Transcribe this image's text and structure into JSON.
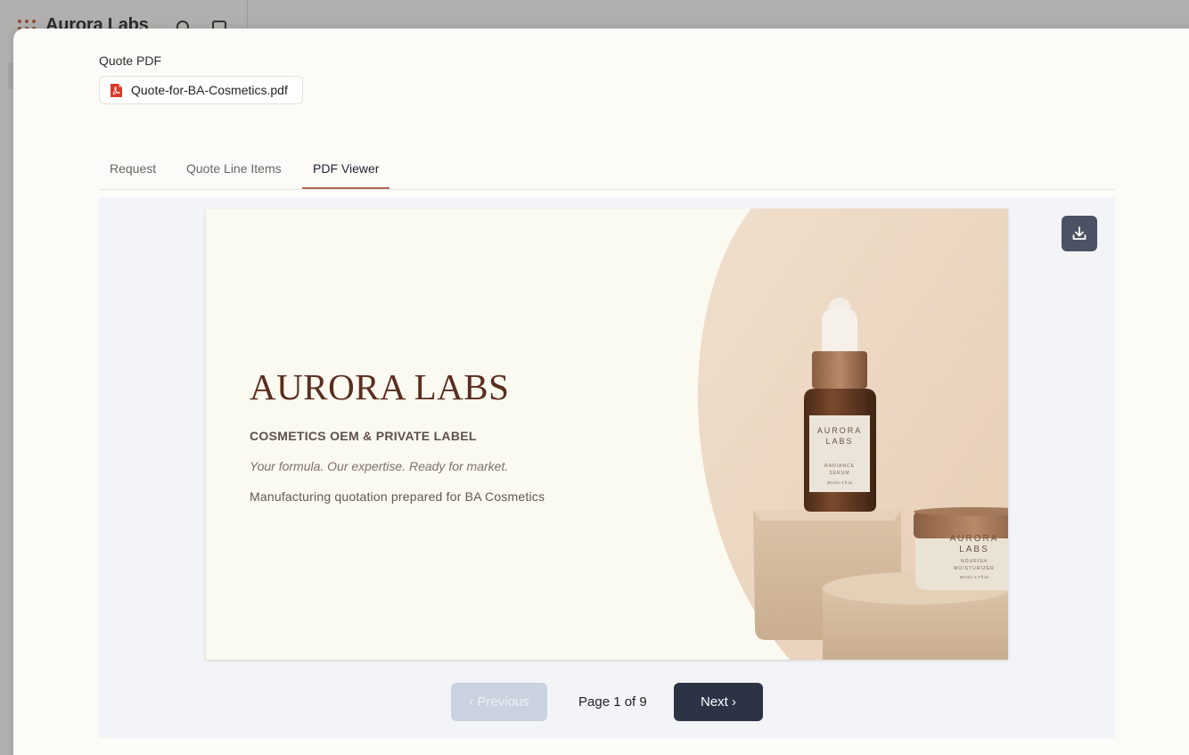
{
  "background_app": {
    "title": "Aurora Labs"
  },
  "modal": {
    "section_label": "Quote PDF",
    "file": {
      "name": "Quote-for-BA-Cosmetics.pdf",
      "icon": "pdf-file-icon"
    }
  },
  "tabs": [
    {
      "label": "Request",
      "active": false
    },
    {
      "label": "Quote Line Items",
      "active": false
    },
    {
      "label": "PDF Viewer",
      "active": true
    }
  ],
  "viewer": {
    "download_icon": "download-icon",
    "page": {
      "brand": "AURORA LABS",
      "subtitle": "COSMETICS OEM & PRIVATE LABEL",
      "tagline": "Your formula. Our expertise. Ready for market.",
      "note": "Manufacturing quotation prepared for BA Cosmetics",
      "bottle_label": {
        "brand_line1": "AURORA",
        "brand_line2": "LABS",
        "product_line1": "RADIANCE",
        "product_line2": "SERUM",
        "size": "30 ml ℮ 1 fl oz"
      },
      "jar_label": {
        "brand_line1": "AURORA",
        "brand_line2": "LABS",
        "product_line1": "NOURISH",
        "product_line2": "MOISTURIZER",
        "size": "50 ml ℮ 1.7 fl oz"
      }
    },
    "pager": {
      "prev_label": "‹ Previous",
      "indicator": "Page 1 of 9",
      "next_label": "Next ›"
    }
  },
  "colors": {
    "accent": "#a86a4d",
    "brand_text": "#5a2e1f",
    "primary_button": "#2b3344",
    "disabled_button": "#c9d2de"
  }
}
